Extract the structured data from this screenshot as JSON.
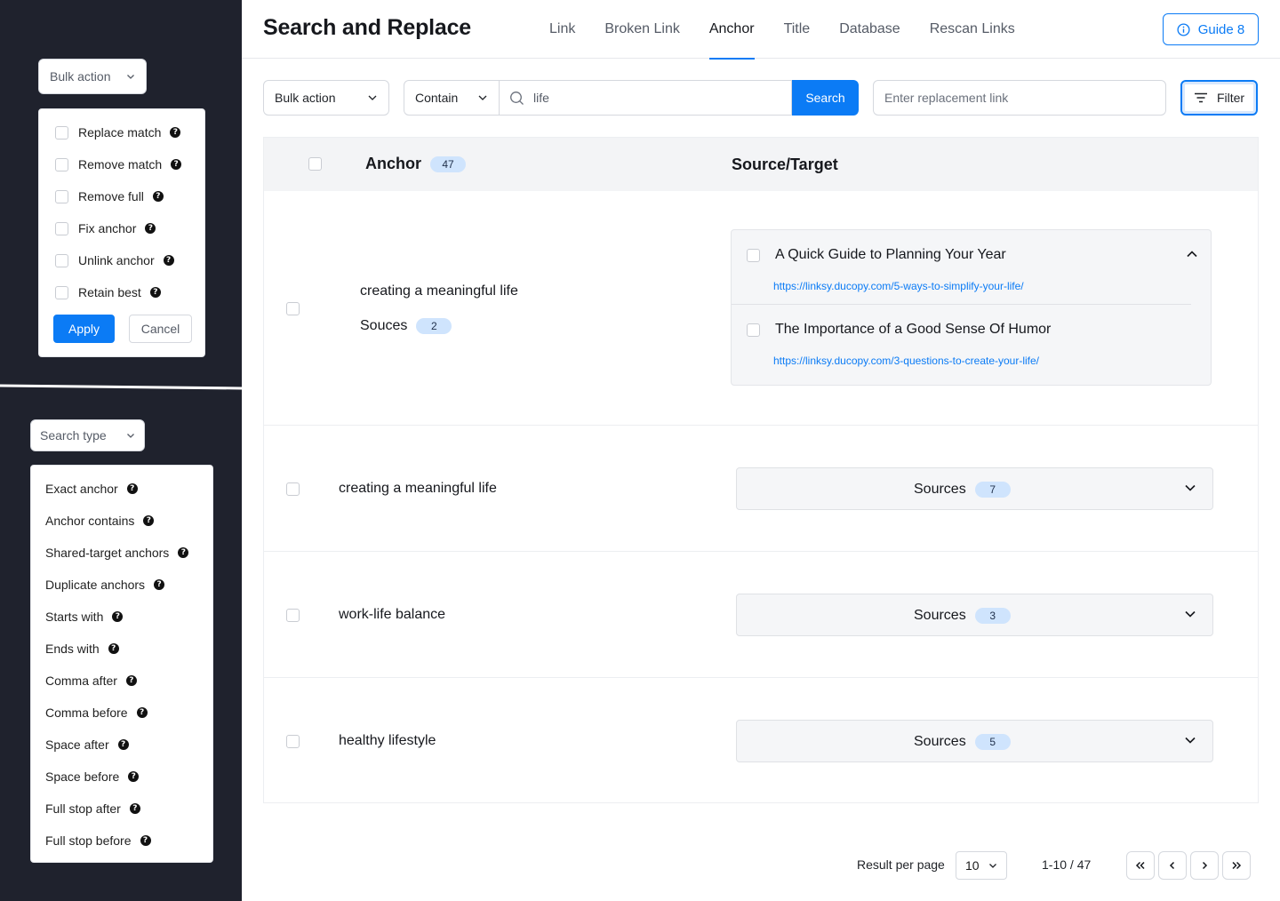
{
  "bulk_panel": {
    "select_label": "Bulk action",
    "options": [
      "Replace match",
      "Remove match",
      "Remove full",
      "Fix anchor",
      "Unlink anchor",
      "Retain best"
    ],
    "apply_label": "Apply",
    "cancel_label": "Cancel"
  },
  "search_type_panel": {
    "select_label": "Search type",
    "options": [
      "Exact anchor",
      "Anchor contains",
      "Shared-target anchors",
      "Duplicate anchors",
      "Starts with",
      "Ends with",
      "Comma after",
      "Comma before",
      "Space after",
      "Space before",
      "Full stop after",
      "Full stop before"
    ]
  },
  "header": {
    "title": "Search and Replace",
    "tabs": [
      "Link",
      "Broken Link",
      "Anchor",
      "Title",
      "Database",
      "Rescan Links"
    ],
    "active_tab": "Anchor",
    "guide_label": "Guide 8"
  },
  "toolbar": {
    "bulk_action": "Bulk action",
    "match_mode": "Contain",
    "search_value": "life",
    "search_label": "Search",
    "replace_placeholder": "Enter replacement link",
    "filter_label": "Filter"
  },
  "table": {
    "anchor_header": "Anchor",
    "anchor_count": "47",
    "source_header": "Source/Target",
    "rows": [
      {
        "anchor": "creating a meaningful life",
        "sources_label": "Souces",
        "sources_count": "2",
        "items": [
          {
            "title": "A Quick Guide to Planning Your Year",
            "url": "https://linksy.ducopy.com/5-ways-to-simplify-your-life/"
          },
          {
            "title": "The Importance of a Good Sense Of Humor",
            "url": "https://linksy.ducopy.com/3-questions-to-create-your-life/"
          }
        ]
      },
      {
        "anchor": "creating a meaningful life",
        "sources_label": "Sources",
        "sources_count": "7"
      },
      {
        "anchor": "work-life balance",
        "sources_label": "Sources",
        "sources_count": "3"
      },
      {
        "anchor": "healthy lifestyle",
        "sources_label": "Sources",
        "sources_count": "5"
      }
    ]
  },
  "pagination": {
    "per_page_label": "Result per page",
    "per_page_value": "10",
    "range": "1-10 / 47"
  },
  "colors": {
    "accent": "#0b7bf5",
    "sidebar_bg": "#1f222d",
    "badge_bg": "#cfe4fd"
  }
}
